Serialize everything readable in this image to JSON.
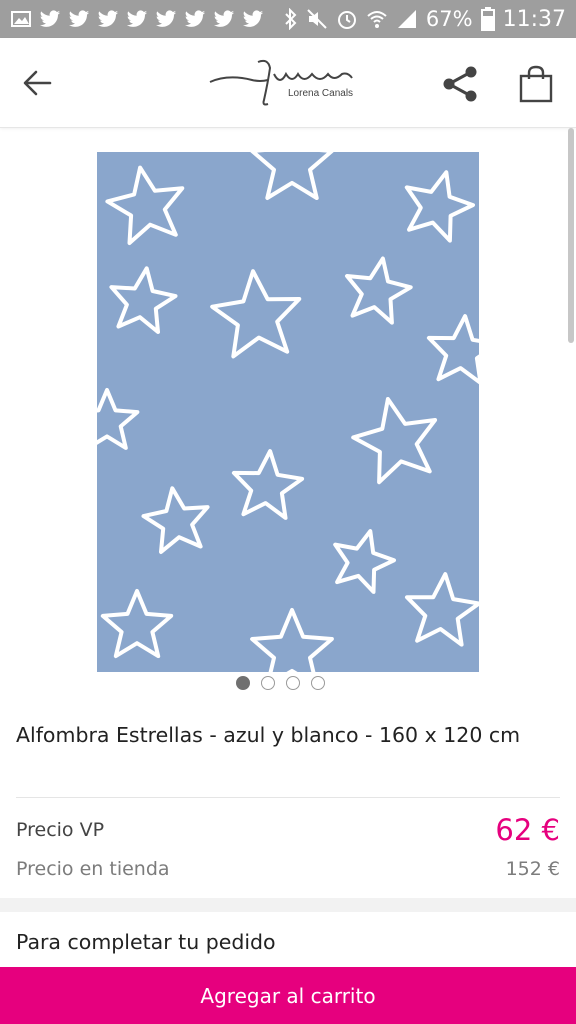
{
  "status_bar": {
    "battery": "67%",
    "time": "11:37",
    "notification_icons": [
      "image-icon",
      "twitter-icon",
      "twitter-icon",
      "twitter-icon",
      "twitter-icon",
      "twitter-icon",
      "twitter-icon",
      "twitter-icon"
    ],
    "system_icons": [
      "bluetooth-icon",
      "mute-icon",
      "alarm-icon",
      "wifi-icon",
      "signal-icon",
      "battery-icon"
    ]
  },
  "header": {
    "logo_script": "Lorena",
    "logo_subtitle": "Lorena Canals",
    "icons": [
      "back-arrow-icon",
      "share-icon",
      "shopping-bag-icon"
    ]
  },
  "product": {
    "image_colors": {
      "rug": "#8aa6cc",
      "stars": "#ffffff"
    },
    "gallery_count": 4,
    "gallery_active": 1,
    "title": "Alfombra Estrellas -  azul y blanco -  160 x 120 cm",
    "price_vp_label": "Precio VP",
    "price_vp_value": "62 €",
    "price_store_label": "Precio en tienda",
    "price_store_value": "152 €"
  },
  "section": {
    "complete_order_title": "Para completar tu pedido"
  },
  "cta": {
    "add_to_cart_label": "Agregar al carrito",
    "color": "#e6007e"
  }
}
